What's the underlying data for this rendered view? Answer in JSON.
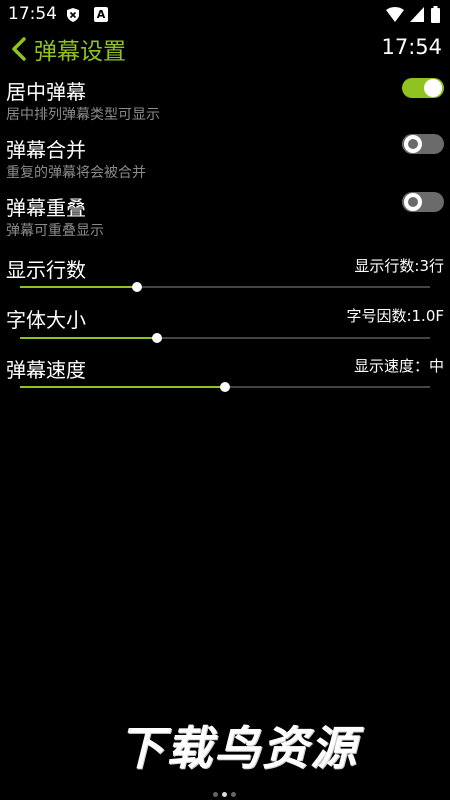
{
  "status_bar": {
    "time": "17:54",
    "icons": [
      "shield-x-icon",
      "a-box-icon",
      "wifi-icon",
      "signal-icon",
      "battery-icon"
    ],
    "a_icon_letter": "A"
  },
  "header": {
    "title": "弹幕设置",
    "time": "17:54",
    "accent_color": "#8fc31f"
  },
  "settings": {
    "center_danmaku": {
      "title": "居中弹幕",
      "subtitle": "居中排列弹幕类型可显示",
      "enabled": true
    },
    "merge_danmaku": {
      "title": "弹幕合并",
      "subtitle": "重复的弹幕将会被合并",
      "enabled": false
    },
    "overlap_danmaku": {
      "title": "弹幕重叠",
      "subtitle": "弹幕可重叠显示",
      "enabled": false
    }
  },
  "sliders": {
    "display_rows": {
      "title": "显示行数",
      "value_label": "显示行数:3行",
      "fraction": 0.285
    },
    "font_size": {
      "title": "字体大小",
      "value_label": "字号因数:1.0F",
      "fraction": 0.333
    },
    "danmaku_speed": {
      "title": "弹幕速度",
      "value_label": "显示速度：中",
      "fraction": 0.5
    }
  },
  "watermark": {
    "text": "下载鸟资源"
  },
  "pager": {
    "count": 3,
    "active_index": 1
  }
}
